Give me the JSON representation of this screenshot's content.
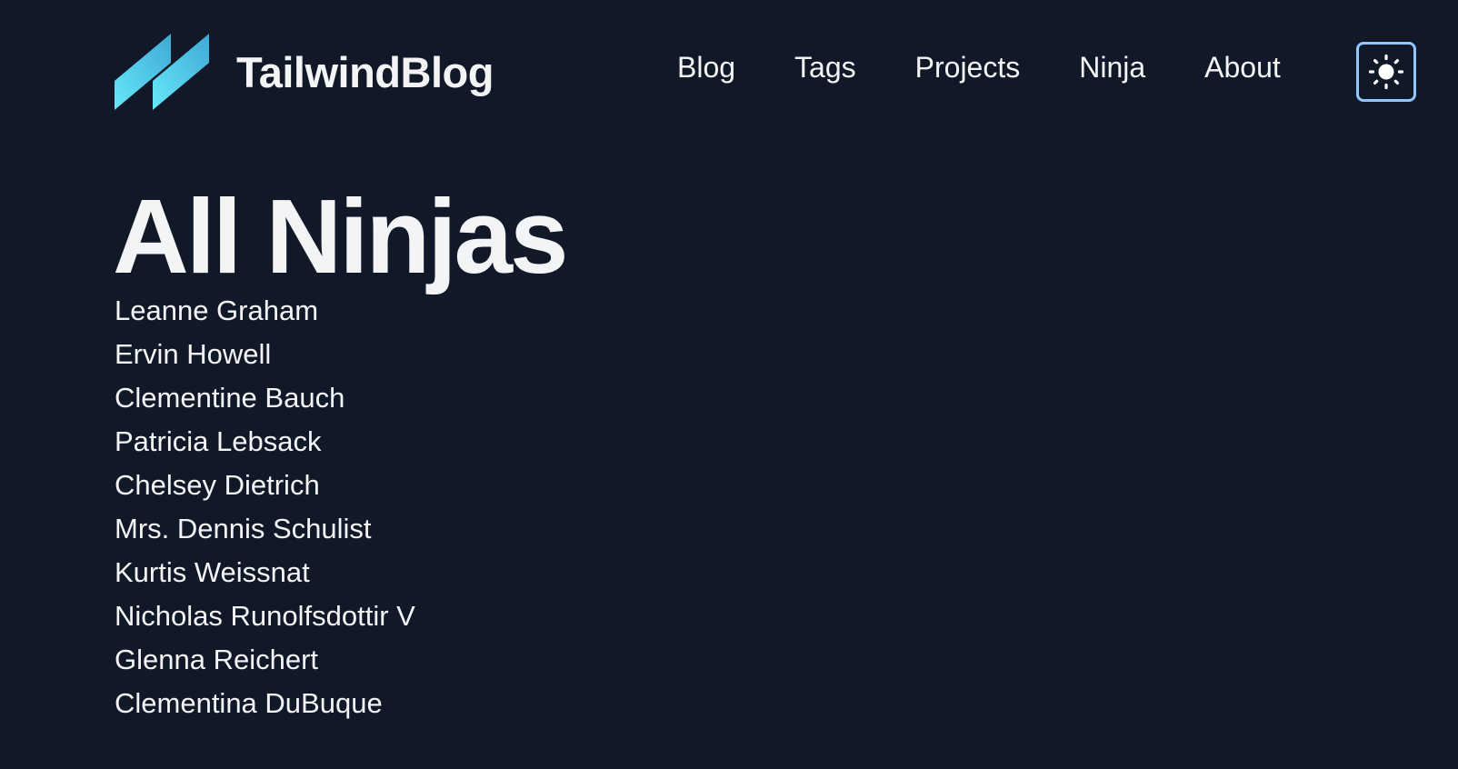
{
  "brand": {
    "name": "TailwindBlog",
    "logo_icon": "tailwind-slash-logo-icon",
    "logo_colors": [
      "#67e8f9",
      "#3fa9d6"
    ]
  },
  "nav": {
    "items": [
      {
        "label": "Blog"
      },
      {
        "label": "Tags"
      },
      {
        "label": "Projects"
      },
      {
        "label": "Ninja"
      },
      {
        "label": "About"
      }
    ]
  },
  "theme_toggle": {
    "icon": "sun-icon",
    "border_color": "#93c5fd"
  },
  "main": {
    "title": "All Ninjas",
    "ninjas": [
      "Leanne Graham",
      "Ervin Howell",
      "Clementine Bauch",
      "Patricia Lebsack",
      "Chelsey Dietrich",
      "Mrs. Dennis Schulist",
      "Kurtis Weissnat",
      "Nicholas Runolfsdottir V",
      "Glenna Reichert",
      "Clementina DuBuque"
    ]
  },
  "colors": {
    "background": "#111827",
    "text": "#f3f4f6"
  }
}
